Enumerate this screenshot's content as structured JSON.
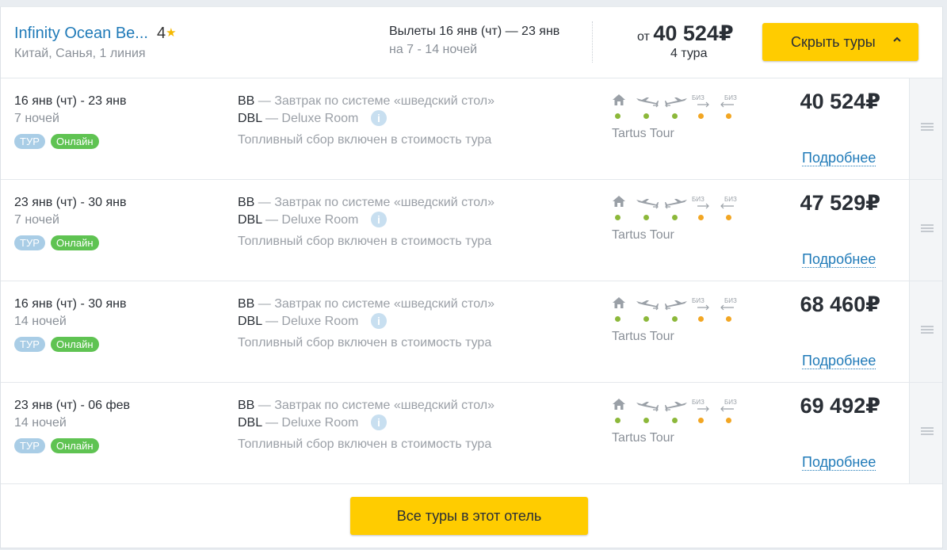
{
  "header": {
    "hotel_name": "Infinity Ocean Be...",
    "stars": "4",
    "location": "Китай, Санья, 1 линия",
    "departures": "Вылеты 16 янв (чт) — 23 янв",
    "nights_range": "на 7 - 14 ночей",
    "price_prefix": "от",
    "price_from": "40 524₽",
    "tours_count": "4 тура",
    "hide_button": "Скрыть туры"
  },
  "service_labels": {
    "biz_outbound": "БИЗ",
    "biz_return": "БИЗ"
  },
  "colors": {
    "accent_button": "#ffcc00",
    "link": "#1f7ab8",
    "dot_ok": "#8cb83a",
    "dot_warn": "#f2a623",
    "badge_online": "#5fc352",
    "badge_tour": "#a9cde6"
  },
  "rows": [
    {
      "dates": "16 янв (чт) - 23 янв",
      "nights": "7 ночей",
      "badge_tour": "ТУР",
      "badge_online": "Онлайн",
      "meal_code": "BB",
      "meal_desc": " — Завтрак по системе «шведский стол»",
      "room_code": "DBL",
      "room_desc": " — Deluxe Room",
      "fuel": "Топливный сбор включен в стоимость тура",
      "operator": "Tartus Tour",
      "price": "40 524₽",
      "more": "Подробнее"
    },
    {
      "dates": "23 янв (чт) - 30 янв",
      "nights": "7 ночей",
      "badge_tour": "ТУР",
      "badge_online": "Онлайн",
      "meal_code": "BB",
      "meal_desc": " — Завтрак по системе «шведский стол»",
      "room_code": "DBL",
      "room_desc": " — Deluxe Room",
      "fuel": "Топливный сбор включен в стоимость тура",
      "operator": "Tartus Tour",
      "price": "47 529₽",
      "more": "Подробнее"
    },
    {
      "dates": "16 янв (чт) - 30 янв",
      "nights": "14 ночей",
      "badge_tour": "ТУР",
      "badge_online": "Онлайн",
      "meal_code": "BB",
      "meal_desc": " — Завтрак по системе «шведский стол»",
      "room_code": "DBL",
      "room_desc": " — Deluxe Room",
      "fuel": "Топливный сбор включен в стоимость тура",
      "operator": "Tartus Tour",
      "price": "68 460₽",
      "more": "Подробнее"
    },
    {
      "dates": "23 янв (чт) - 06 фев",
      "nights": "14 ночей",
      "badge_tour": "ТУР",
      "badge_online": "Онлайн",
      "meal_code": "BB",
      "meal_desc": " — Завтрак по системе «шведский стол»",
      "room_code": "DBL",
      "room_desc": " — Deluxe Room",
      "fuel": "Топливный сбор включен в стоимость тура",
      "operator": "Tartus Tour",
      "price": "69 492₽",
      "more": "Подробнее"
    }
  ],
  "footer": {
    "all_tours_button": "Все туры в этот отель"
  }
}
